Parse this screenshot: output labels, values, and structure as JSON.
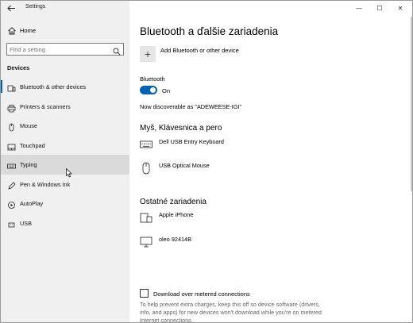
{
  "app": {
    "title": "Settings",
    "back_icon": "back-arrow-icon"
  },
  "sidebar": {
    "home_label": "Home",
    "search_placeholder": "Find a setting",
    "section_header": "Devices",
    "items": [
      {
        "label": "Bluetooth & other devices",
        "icon": "bluetooth-devices-icon",
        "selected": true
      },
      {
        "label": "Printers & scanners",
        "icon": "printer-icon"
      },
      {
        "label": "Mouse",
        "icon": "mouse-icon"
      },
      {
        "label": "Touchpad",
        "icon": "touchpad-icon"
      },
      {
        "label": "Typing",
        "icon": "keyboard-icon",
        "hovered": true
      },
      {
        "label": "Pen & Windows Ink",
        "icon": "pen-icon"
      },
      {
        "label": "AutoPlay",
        "icon": "autoplay-icon"
      },
      {
        "label": "USB",
        "icon": "usb-icon"
      }
    ]
  },
  "window_controls": {
    "minimize": "—",
    "maximize": "☐",
    "close": "✕"
  },
  "main": {
    "title": "Bluetooth a ďalšie zariadenia",
    "add_button_symbol": "+",
    "add_label": "Add Bluetooth or other device",
    "bluetooth_label": "Bluetooth",
    "toggle_state": "On",
    "discoverable": "Now discoverable as \"ADEWEESE-IGI\"",
    "groups": [
      {
        "title": "Myš, Klávesnica a pero",
        "devices": [
          {
            "name": "Dell USB Entry Keyboard",
            "icon": "keyboard-icon"
          },
          {
            "name": "USB Optical Mouse",
            "icon": "mouse-icon"
          }
        ]
      },
      {
        "title": "Ostatné zariadenia",
        "devices": [
          {
            "name": "Apple iPhone",
            "icon": "phone-icon"
          },
          {
            "name": "oleo 92414B",
            "icon": "monitor-icon"
          }
        ]
      }
    ],
    "metered_label": "Download over metered connections",
    "help_text": "To help prevent extra charges, keep this off so device software (drivers, info, and apps) for new devices won't download while you're on metered Internet connections."
  },
  "colors": {
    "accent": "#0063b1",
    "sidebar_bg": "#f0f0f0",
    "hover_bg": "#dadada"
  }
}
